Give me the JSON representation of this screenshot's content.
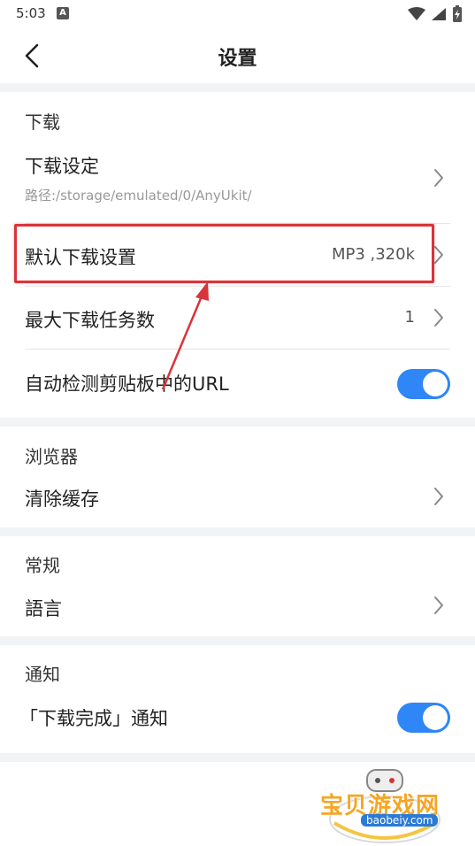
{
  "status_bar": {
    "time": "5:03",
    "notif_letter": "A"
  },
  "header": {
    "title": "设置"
  },
  "sections": {
    "download": {
      "title": "下载",
      "settings_label": "下载设定",
      "path": "路径:/storage/emulated/0/AnyUkit/",
      "default_label": "默认下载设置",
      "default_value": "MP3 ,320k",
      "max_label": "最大下载任务数",
      "max_value": "1",
      "clipboard_label": "自动检测剪贴板中的URL",
      "clipboard_on": true
    },
    "browser": {
      "title": "浏览器",
      "clear_cache_label": "清除缓存"
    },
    "general": {
      "title": "常规",
      "language_label": "語言"
    },
    "notification": {
      "title": "通知",
      "download_done_label": "「下载完成」通知",
      "download_done_on": true
    }
  },
  "watermark": {
    "text": "宝贝游戏网",
    "url": "baobeiy.com"
  },
  "colors": {
    "toggle_on": "#2f86f6",
    "highlight": "#d9343a",
    "background_gap": "#f2f3f5"
  }
}
